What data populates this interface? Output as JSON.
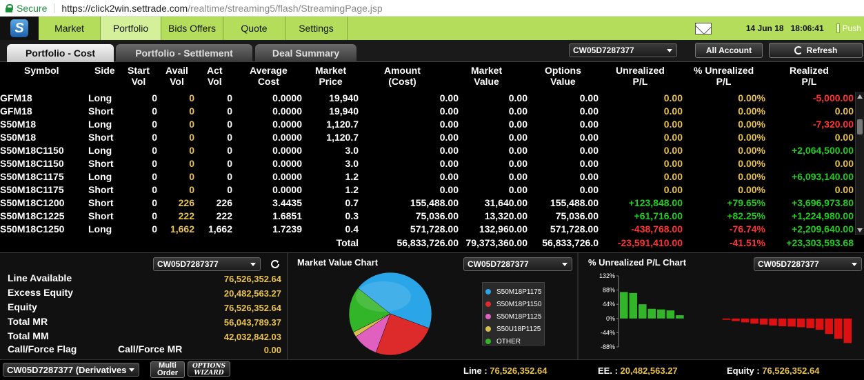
{
  "browser": {
    "secure_label": "Secure",
    "url_host": "https://click2win.settrade.com",
    "url_path": "/realtime/streaming5/flash/StreamingPage.jsp"
  },
  "nav": {
    "tabs": [
      "Market",
      "Portfolio",
      "Bids Offers",
      "Quote",
      "Settings"
    ],
    "active": "Portfolio",
    "date": "14 Jun 18",
    "time": "18:06:41",
    "push_label": "Push"
  },
  "subtabs": [
    "Portfolio - Cost",
    "Portfolio - Settlement",
    "Deal Summary"
  ],
  "account_select": "CW05D7287377",
  "all_account_label": "All Account",
  "refresh_label": "Refresh",
  "table": {
    "headers": [
      [
        "Symbol"
      ],
      [
        "Side"
      ],
      [
        "Start",
        "Vol"
      ],
      [
        "Avail",
        "Vol"
      ],
      [
        "Act",
        "Vol"
      ],
      [
        "Average",
        "Cost"
      ],
      [
        "Market",
        "Price"
      ],
      [
        "Amount",
        "(Cost)"
      ],
      [
        "Market",
        "Value"
      ],
      [
        "Options",
        "Value"
      ],
      [
        "Unrealized",
        "P/L"
      ],
      [
        "% Unrealized",
        "P/L"
      ],
      [
        "Realized",
        "P/L"
      ]
    ],
    "rows": [
      {
        "symbol": "GFM18",
        "side": "Long",
        "start": "0",
        "avail": "0",
        "act": "0",
        "avg": "0.0000",
        "price": "19,940",
        "amount": "0.00",
        "mval": "0.00",
        "oval": "0.00",
        "upl": "0.00",
        "pupl": "0.00%",
        "rpl": "-5,000.00"
      },
      {
        "symbol": "GFM18",
        "side": "Short",
        "start": "0",
        "avail": "0",
        "act": "0",
        "avg": "0.0000",
        "price": "19,940",
        "amount": "0.00",
        "mval": "0.00",
        "oval": "0.00",
        "upl": "0.00",
        "pupl": "0.00%",
        "rpl": "0.00"
      },
      {
        "symbol": "S50M18",
        "side": "Long",
        "start": "0",
        "avail": "0",
        "act": "0",
        "avg": "0.0000",
        "price": "1,120.7",
        "amount": "0.00",
        "mval": "0.00",
        "oval": "0.00",
        "upl": "0.00",
        "pupl": "0.00%",
        "rpl": "-7,320.00"
      },
      {
        "symbol": "S50M18",
        "side": "Short",
        "start": "0",
        "avail": "0",
        "act": "0",
        "avg": "0.0000",
        "price": "1,120.7",
        "amount": "0.00",
        "mval": "0.00",
        "oval": "0.00",
        "upl": "0.00",
        "pupl": "0.00%",
        "rpl": "0.00"
      },
      {
        "symbol": "S50M18C1150",
        "side": "Long",
        "start": "0",
        "avail": "0",
        "act": "0",
        "avg": "0.0000",
        "price": "3.0",
        "amount": "0.00",
        "mval": "0.00",
        "oval": "0.00",
        "upl": "0.00",
        "pupl": "0.00%",
        "rpl": "+2,064,500.00"
      },
      {
        "symbol": "S50M18C1150",
        "side": "Short",
        "start": "0",
        "avail": "0",
        "act": "0",
        "avg": "0.0000",
        "price": "3.0",
        "amount": "0.00",
        "mval": "0.00",
        "oval": "0.00",
        "upl": "0.00",
        "pupl": "0.00%",
        "rpl": "0.00"
      },
      {
        "symbol": "S50M18C1175",
        "side": "Long",
        "start": "0",
        "avail": "0",
        "act": "0",
        "avg": "0.0000",
        "price": "1.2",
        "amount": "0.00",
        "mval": "0.00",
        "oval": "0.00",
        "upl": "0.00",
        "pupl": "0.00%",
        "rpl": "+6,093,140.00"
      },
      {
        "symbol": "S50M18C1175",
        "side": "Short",
        "start": "0",
        "avail": "0",
        "act": "0",
        "avg": "0.0000",
        "price": "1.2",
        "amount": "0.00",
        "mval": "0.00",
        "oval": "0.00",
        "upl": "0.00",
        "pupl": "0.00%",
        "rpl": "0.00"
      },
      {
        "symbol": "S50M18C1200",
        "side": "Short",
        "start": "0",
        "avail": "226",
        "act": "226",
        "avg": "3.4435",
        "price": "0.7",
        "amount": "155,488.00",
        "mval": "31,640.00",
        "oval": "155,488.00",
        "upl": "+123,848.00",
        "pupl": "+79.65%",
        "rpl": "+3,696,973.80"
      },
      {
        "symbol": "S50M18C1225",
        "side": "Short",
        "start": "0",
        "avail": "222",
        "act": "222",
        "avg": "1.6851",
        "price": "0.3",
        "amount": "75,036.00",
        "mval": "13,320.00",
        "oval": "75,036.00",
        "upl": "+61,716.00",
        "pupl": "+82.25%",
        "rpl": "+1,224,980.00"
      },
      {
        "symbol": "S50M18C1250",
        "side": "Long",
        "start": "0",
        "avail": "1,662",
        "act": "1,662",
        "avg": "1.7239",
        "price": "0.4",
        "amount": "571,728.00",
        "mval": "132,960.00",
        "oval": "571,728.00",
        "upl": "-438,768.00",
        "pupl": "-76.74%",
        "rpl": "+2,209,640.00"
      }
    ],
    "total": {
      "label": "Total",
      "amount": "56,833,726.00",
      "mval": "79,373,360.00",
      "oval": "56,833,726.0",
      "upl": "-23,591,410.00",
      "pupl": "-41.51%",
      "rpl": "+23,303,593.68"
    }
  },
  "account_panel": {
    "select": "CW05D7287377",
    "items": [
      {
        "label": "Line Available",
        "value": "76,526,352.64"
      },
      {
        "label": "Excess Equity",
        "value": "20,482,563.27"
      },
      {
        "label": "Equity",
        "value": "76,526,352.64"
      },
      {
        "label": "Total MR",
        "value": "56,043,789.37"
      },
      {
        "label": "Total MM",
        "value": "42,032,842.03"
      }
    ],
    "flag_label": "Call/Force Flag",
    "mr_label": "Call/Force MR",
    "mr_value": "0.00"
  },
  "market_value_chart": {
    "title": "Market Value Chart",
    "select": "CW05D7287377"
  },
  "pl_chart": {
    "title": "% Unrealized P/L Chart",
    "select": "CW05D7287377"
  },
  "chart_data": [
    {
      "type": "pie",
      "title": "Market Value Chart",
      "categories": [
        "S50M18P1175",
        "S50M18P1150",
        "S50M18P1125",
        "S50U18P1125",
        "OTHER"
      ],
      "values": [
        45,
        25,
        10,
        2,
        18
      ],
      "colors": [
        "#2aa6e8",
        "#dd2b2b",
        "#e060c0",
        "#d8c050",
        "#33b52a"
      ]
    },
    {
      "type": "bar",
      "title": "% Unrealized P/L Chart",
      "yticks": [
        "132%",
        "88%",
        "44%",
        "0%",
        "-44%",
        "-88%"
      ],
      "ylim": [
        -88,
        132
      ],
      "values": [
        82,
        79,
        44,
        30,
        28,
        25,
        10,
        -4,
        -8,
        -12,
        -16,
        -19,
        -22,
        -24,
        -25,
        -27,
        -30,
        -35,
        -48,
        -63,
        -76
      ],
      "pos_color": "#33b52a",
      "neg_color": "#dd1111"
    }
  ],
  "status": {
    "account_select": "CW05D7287377 (Derivatives",
    "multi_order": [
      "Multi",
      "Order"
    ],
    "options_wizard": [
      "OPTIONS",
      "WIZARD"
    ],
    "line_label": "Line :",
    "line_value": "76,526,352.64",
    "ee_label": "EE. :",
    "ee_value": "20,482,563.27",
    "equity_label": "Equity :",
    "equity_value": "76,526,352.64"
  }
}
